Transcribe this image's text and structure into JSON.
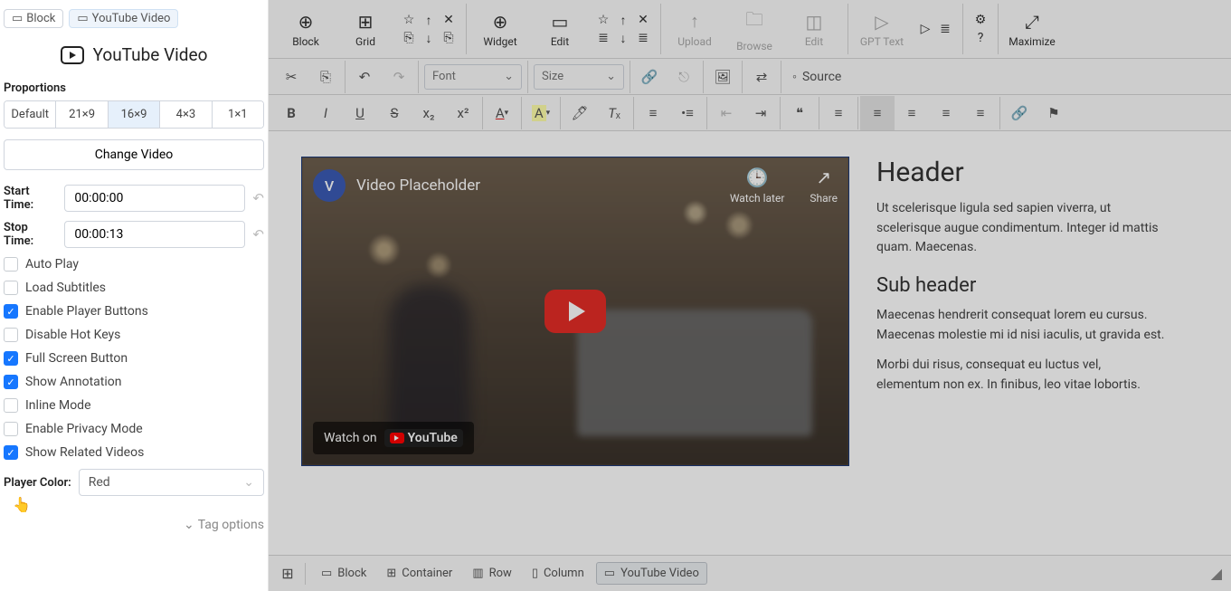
{
  "sidebar": {
    "crumbs": [
      {
        "id": "block",
        "label": "Block"
      },
      {
        "id": "yt",
        "label": "YouTube Video"
      }
    ],
    "title": "YouTube Video",
    "proportions_label": "Proportions",
    "proportions": [
      "Default",
      "21×9",
      "16×9",
      "4×3",
      "1×1"
    ],
    "proportions_active": "16×9",
    "change_video_label": "Change Video",
    "start_label": "Start Time:",
    "start_value": "00:00:00",
    "stop_label": "Stop Time:",
    "stop_value": "00:00:13",
    "checks": [
      {
        "id": "autoplay",
        "label": "Auto Play",
        "checked": false
      },
      {
        "id": "subs",
        "label": "Load Subtitles",
        "checked": false
      },
      {
        "id": "btns",
        "label": "Enable Player Buttons",
        "checked": true
      },
      {
        "id": "hotkeys",
        "label": "Disable Hot Keys",
        "checked": false
      },
      {
        "id": "full",
        "label": "Full Screen Button",
        "checked": true
      },
      {
        "id": "annot",
        "label": "Show Annotation",
        "checked": true
      },
      {
        "id": "inline",
        "label": "Inline Mode",
        "checked": false
      },
      {
        "id": "privacy",
        "label": "Enable Privacy Mode",
        "checked": false
      },
      {
        "id": "related",
        "label": "Show Related Videos",
        "checked": true
      }
    ],
    "player_color_label": "Player Color:",
    "player_color_value": "Red",
    "tag_options": "Tag options"
  },
  "toolbar1": {
    "groups": [
      {
        "items": [
          {
            "id": "block",
            "label": "Block",
            "icon": "⊕"
          },
          {
            "id": "grid",
            "label": "Grid",
            "icon": "⊞"
          }
        ],
        "mini": [
          "☆",
          "↑",
          "✕",
          "⎘",
          "↓",
          "⎘"
        ]
      },
      {
        "items": [
          {
            "id": "widget",
            "label": "Widget",
            "icon": "⊕"
          },
          {
            "id": "edit",
            "label": "Edit",
            "icon": "▭"
          }
        ],
        "mini": [
          "☆",
          "↑",
          "✕",
          "≣",
          "↓",
          "≣"
        ]
      },
      {
        "items": [
          {
            "id": "upload",
            "label": "Upload",
            "icon": "↑",
            "disabled": true
          },
          {
            "id": "browse",
            "label": "Browse",
            "icon": "🗀",
            "disabled": true
          },
          {
            "id": "iedit",
            "label": "Edit",
            "icon": "◫",
            "disabled": true
          }
        ]
      },
      {
        "items": [
          {
            "id": "gpt",
            "label": "GPT Text",
            "icon": "▷",
            "disabled": true
          }
        ],
        "mini": [
          "▷",
          "≣"
        ]
      },
      {
        "mini2": [
          "⚙",
          "?"
        ]
      },
      {
        "items": [
          {
            "id": "max",
            "label": "Maximize",
            "icon": "⤢"
          }
        ]
      }
    ]
  },
  "row2": {
    "font_label": "Font",
    "size_label": "Size",
    "source_label": "Source"
  },
  "content": {
    "video_title": "Video Placeholder",
    "watch_later": "Watch later",
    "share": "Share",
    "watch_on": "Watch on",
    "youtube": "YouTube",
    "header": "Header",
    "p1": "Ut scelerisque ligula sed sapien viverra, ut scelerisque augue condimentum. Integer id mattis quam. Maecenas.",
    "sub": "Sub header",
    "p2": "Maecenas hendrerit consequat lorem eu cursus. Maecenas molestie mi id nisi iaculis, ut gravida est.",
    "p3": "Morbi dui risus, consequat eu luctus vel, elementum non ex. In finibus, leo vitae lobortis."
  },
  "status": {
    "items": [
      {
        "id": "block",
        "label": "Block",
        "icon": "▭"
      },
      {
        "id": "container",
        "label": "Container",
        "icon": "⊞"
      },
      {
        "id": "row",
        "label": "Row",
        "icon": "▥"
      },
      {
        "id": "col",
        "label": "Column",
        "icon": "▯"
      },
      {
        "id": "yt",
        "label": "YouTube Video",
        "icon": "▭",
        "active": true
      }
    ]
  }
}
